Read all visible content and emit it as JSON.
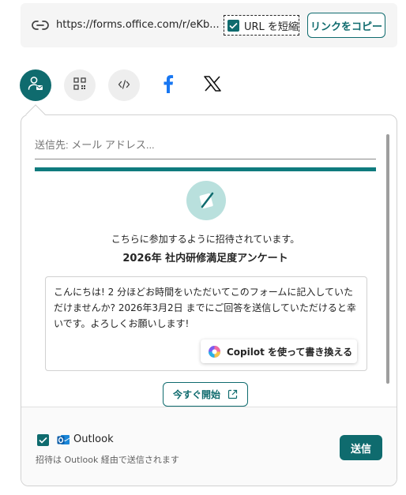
{
  "link": {
    "url": "https://forms.office.com/r/eKb...",
    "shorten_label": "URL を短縮",
    "shorten_checked": true,
    "copy_label": "リンクをコピー"
  },
  "share": {
    "buttons": [
      {
        "name": "email-invite",
        "icon": "person-mail-icon",
        "active": true
      },
      {
        "name": "qr-code",
        "icon": "qr-code-icon",
        "active": false
      },
      {
        "name": "embed",
        "icon": "code-icon",
        "active": false
      },
      {
        "name": "facebook",
        "icon": "facebook-icon",
        "active": false
      },
      {
        "name": "x",
        "icon": "x-logo-icon",
        "active": false
      }
    ]
  },
  "email": {
    "placeholder": "送信先: メール アドレス..."
  },
  "preview": {
    "invite_text": "こちらに参加するように招待されています。",
    "form_title": "2026年 社内研修満足度アンケート",
    "message": "こんにちは! 2 分ほどお時間をいただいてこのフォームに記入していただけませんか? 2026年3月2日 までにご回答を送信していただけると幸いです。よろしくお願いします!",
    "copilot_label": "Copilot を使って書き換える",
    "start_label": "今すぐ開始"
  },
  "footer": {
    "outlook_label": "Outlook",
    "outlook_checked": true,
    "note": "招待は Outlook 経由で送信されます",
    "send_label": "送信"
  },
  "colors": {
    "accent": "#0f6b6e",
    "accent_bar": "#0f7b7e",
    "form_icon_bg": "#b9e0dd"
  }
}
